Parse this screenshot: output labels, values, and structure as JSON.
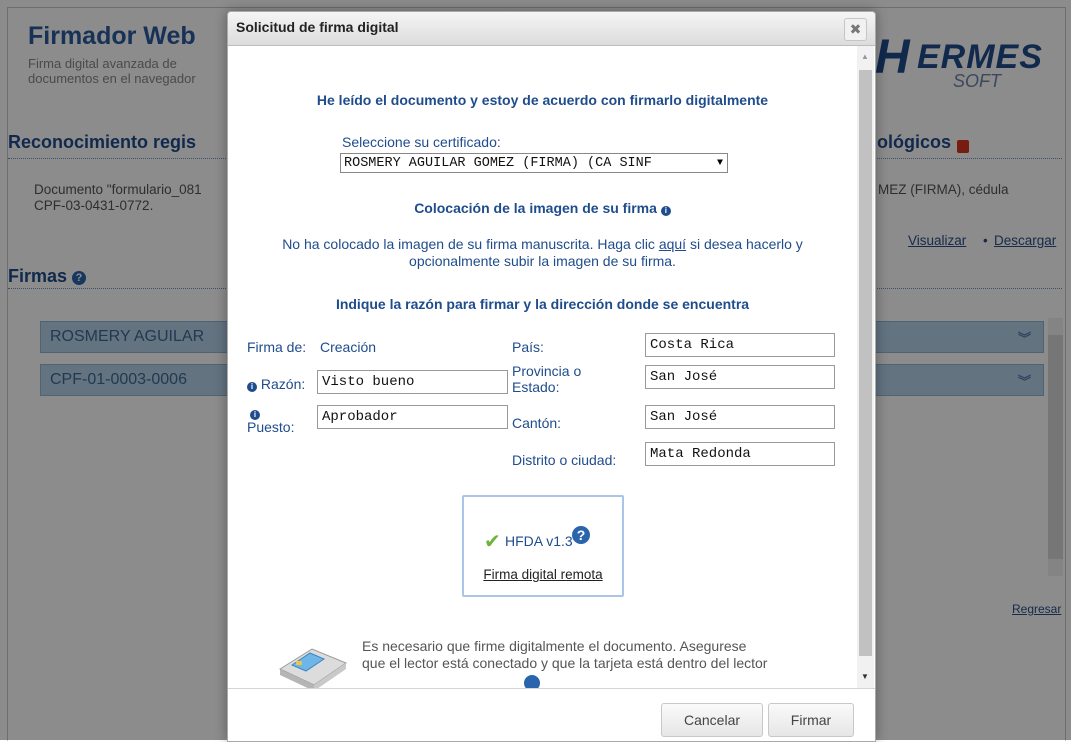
{
  "background": {
    "brand_title": "Firmador Web",
    "brand_sub_1": "Firma digital avanzada de",
    "brand_sub_2": "documentos en el navegador",
    "logo_h": "H",
    "logo_ermes": "ERMES",
    "logo_soft": "SOFT",
    "section_recon": "Reconocimiento regis",
    "section_tech": "ológicos",
    "doc_text_1": "Documento \"formulario_081",
    "doc_text_2": "CPF-03-0431-0772.",
    "doc_text_right": "MEZ (FIRMA), cédula",
    "link_visualizar": "Visualizar",
    "link_sep": "•",
    "link_descargar": "Descargar",
    "section_firmas": "Firmas",
    "firmas_help_glyph": "?",
    "firma_rows": [
      "ROSMERY AGUILAR",
      "CPF-01-0003-0006"
    ],
    "link_regresar": "Regresar"
  },
  "modal": {
    "title": "Solicitud de firma digital",
    "close_glyph": "✖",
    "agree_heading": "He leído el documento y estoy de acuerdo con firmarlo digitalmente",
    "cert_label": "Seleccione su certificado:",
    "cert_selected": "ROSMERY AGUILAR GOMEZ (FIRMA) (CA SINF",
    "coloc_heading": "Colocación de la imagen de su firma",
    "coloc_text_1_pre": "No ha colocado la imagen de su firma manuscrita. Haga clic ",
    "coloc_text_1_link": "aquí",
    "coloc_text_1_post": " si desea hacerlo y",
    "coloc_text_2": "opcionalmente subir la imagen de su firma.",
    "razon_heading": "Indique la razón para firmar y la dirección donde se encuentra",
    "form": {
      "firma_de_label": "Firma de:",
      "firma_de_value": "Creación",
      "razon_label": "Razón:",
      "razon_value": "Visto bueno",
      "puesto_label": "Puesto:",
      "puesto_value": "Aprobador",
      "pais_label": "País:",
      "pais_value": "Costa Rica",
      "provincia_label_1": "Provincia o",
      "provincia_label_2": "Estado:",
      "provincia_value": "San José",
      "canton_label": "Cantón:",
      "canton_value": "San José",
      "distrito_label": "Distrito o ciudad:",
      "distrito_value": "Mata Redonda"
    },
    "hfda_label": "HFDA v1.3",
    "hfda_help_glyph": "?",
    "hfda_remote": "Firma digital remota",
    "reader_text_1": "Es necesario que firme digitalmente el documento. Asegurese",
    "reader_text_2": "que el lector está conectado y que la tarjeta está dentro del lector",
    "btn_cancelar": "Cancelar",
    "btn_firmar": "Firmar"
  },
  "colors": {
    "brand_blue": "#1f4c8c",
    "firma_bar": "#b4d2ea",
    "hfda_check": "#6bb33a"
  }
}
